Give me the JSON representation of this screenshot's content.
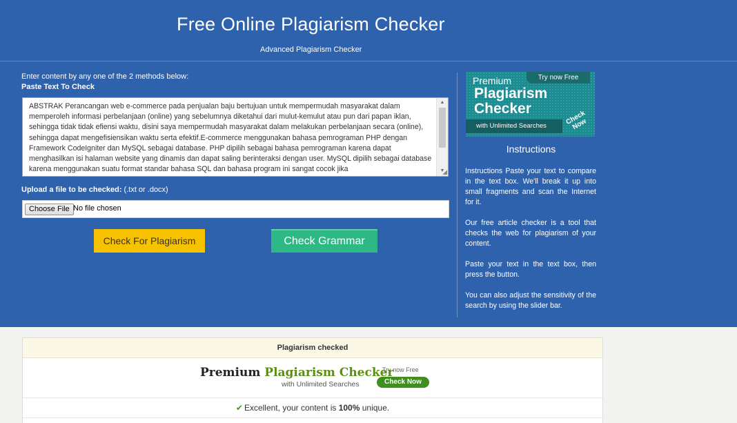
{
  "header": {
    "title": "Free Online Plagiarism Checker",
    "subtitle": "Advanced Plagiarism Checker"
  },
  "form": {
    "intro": "Enter content by any one of the 2 methods below:",
    "paste_label": "Paste Text To Check",
    "text_value": "ABSTRAK Perancangan web e-commerce pada penjualan baju bertujuan untuk mempermudah masyarakat dalam memperoleh informasi perbelanjaan (online) yang sebelumnya diketahui dari mulut-kemulut atau pun dari papan iklan, sehingga tidak tidak efiensi waktu, disini saya mempermudah masyarakat dalam melakukan perbelanjaan secara (online), sehingga dapat mengefisiensikan waktu serta efektif.E-commerce menggunakan bahasa pemrograman PHP dengan Framework CodeIgniter dan MySQL sebagai database. PHP dipilih sebagai bahasa pemrograman karena dapat menghasilkan isi halaman website yang dinamis dan dapat saling berinteraksi dengan user. MySQL dipilih sebagai database karena menggunakan suatu format standar bahasa SQL dan bahasa program ini sangat cocok jika",
    "upload_label_bold": "Upload a file to be checked:",
    "upload_label_hint": " (.txt or .docx)",
    "choose_file_label": "Choose File",
    "no_file_text": "No file chosen",
    "check_plagiarism_label": "Check For Plagiarism",
    "check_grammar_label": "Check Grammar"
  },
  "sidebar": {
    "ad": {
      "premium": "Premium",
      "title": "Plagiarism Checker",
      "try_now": "Try now Free",
      "unlimited": "with Unlimited Searches",
      "check_now": "Check Now"
    },
    "instructions_title": "Instructions",
    "instructions": [
      "Instructions Paste your text to compare in the text box. We'll break it up into small fragments and scan the Internet for it.",
      "Our free article checker is a tool that checks the web for plagiarism of your content.",
      "Paste your text in the text box, then press the button.",
      "You can also adjust the sensitivity of the search by using the slider bar."
    ]
  },
  "results": {
    "heading": "Plagiarism checked",
    "ad": {
      "premium": "Premium ",
      "title": "Plagiarism Checker",
      "unlimited": "with Unlimited Searches",
      "try_now": "Try now Free",
      "check_now": "Check Now"
    },
    "status_prefix": "Excellent, your content is ",
    "status_value": "100%",
    "status_suffix": " unique."
  },
  "colors": {
    "header_bg": "#2f62ad",
    "plagiarism_button": "#f7c200",
    "grammar_button": "#2eb886",
    "success_green": "#3f8f1f"
  }
}
